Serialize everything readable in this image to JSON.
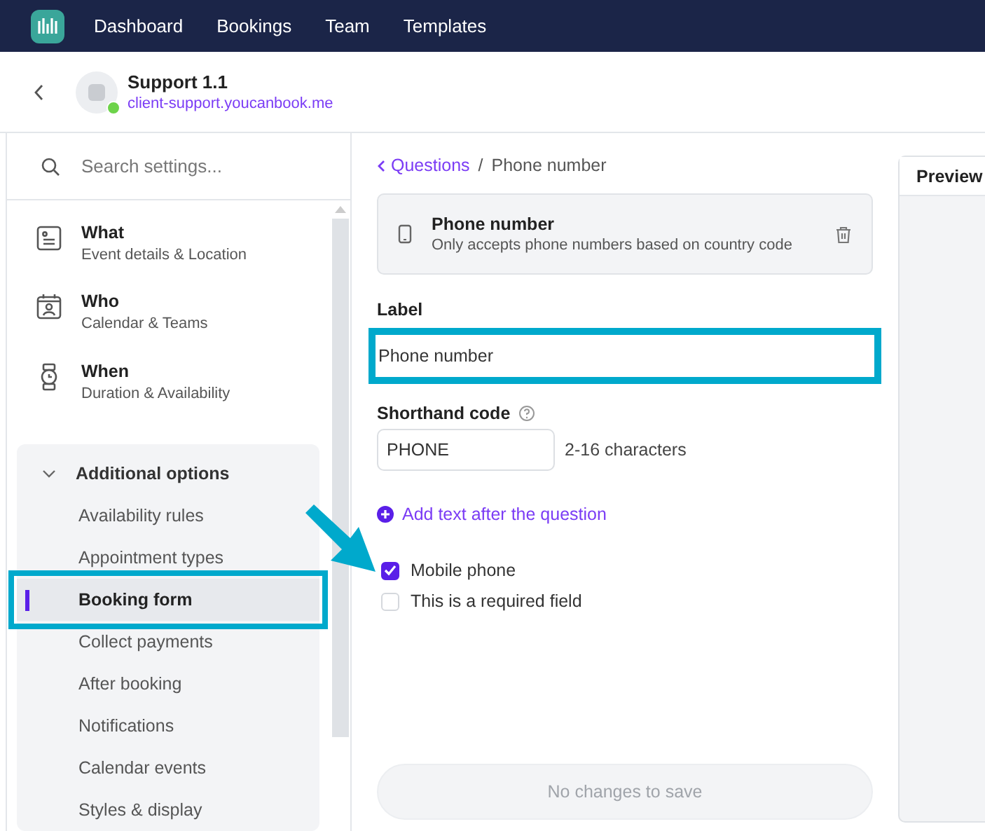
{
  "top_nav": {
    "items": [
      {
        "label": "Dashboard"
      },
      {
        "label": "Bookings"
      },
      {
        "label": "Team"
      },
      {
        "label": "Templates"
      }
    ]
  },
  "header": {
    "title": "Support 1.1",
    "link": "client-support.youcanbook.me",
    "online": true
  },
  "sidebar": {
    "search": {
      "placeholder": "Search settings..."
    },
    "sections": [
      {
        "kind": "what",
        "title": "What",
        "subtitle": "Event details & Location"
      },
      {
        "kind": "who",
        "title": "Who",
        "subtitle": "Calendar & Teams"
      },
      {
        "kind": "when",
        "title": "When",
        "subtitle": "Duration & Availability"
      }
    ],
    "group": {
      "title": "Additional options",
      "expanded": true,
      "items": [
        {
          "label": "Availability rules",
          "selected": false,
          "highlighted": false
        },
        {
          "label": "Appointment types",
          "selected": false,
          "highlighted": false
        },
        {
          "label": "Booking form",
          "selected": true,
          "highlighted": true
        },
        {
          "label": "Collect payments",
          "selected": false,
          "highlighted": false
        },
        {
          "label": "After booking",
          "selected": false,
          "highlighted": false
        },
        {
          "label": "Notifications",
          "selected": false,
          "highlighted": false
        },
        {
          "label": "Calendar events",
          "selected": false,
          "highlighted": false
        },
        {
          "label": "Styles & display",
          "selected": false,
          "highlighted": false
        }
      ]
    }
  },
  "editor": {
    "breadcrumb": {
      "back": "Questions",
      "separator": "/",
      "current": "Phone number"
    },
    "question_card": {
      "title": "Phone number",
      "description": "Only accepts phone numbers based on country code"
    },
    "label_field": {
      "label": "Label",
      "value": "Phone number",
      "highlighted": true
    },
    "shorthand": {
      "label": "Shorthand code",
      "value": "PHONE",
      "hint": "2-16 characters"
    },
    "add_text_link": "Add text after the question",
    "options": [
      {
        "label": "Mobile phone",
        "checked": true,
        "arrow": true
      },
      {
        "label": "This is a required field",
        "checked": false,
        "arrow": false
      }
    ],
    "save_button": {
      "label": "No changes to save",
      "disabled": true
    }
  },
  "preview": {
    "tab": "Preview"
  }
}
